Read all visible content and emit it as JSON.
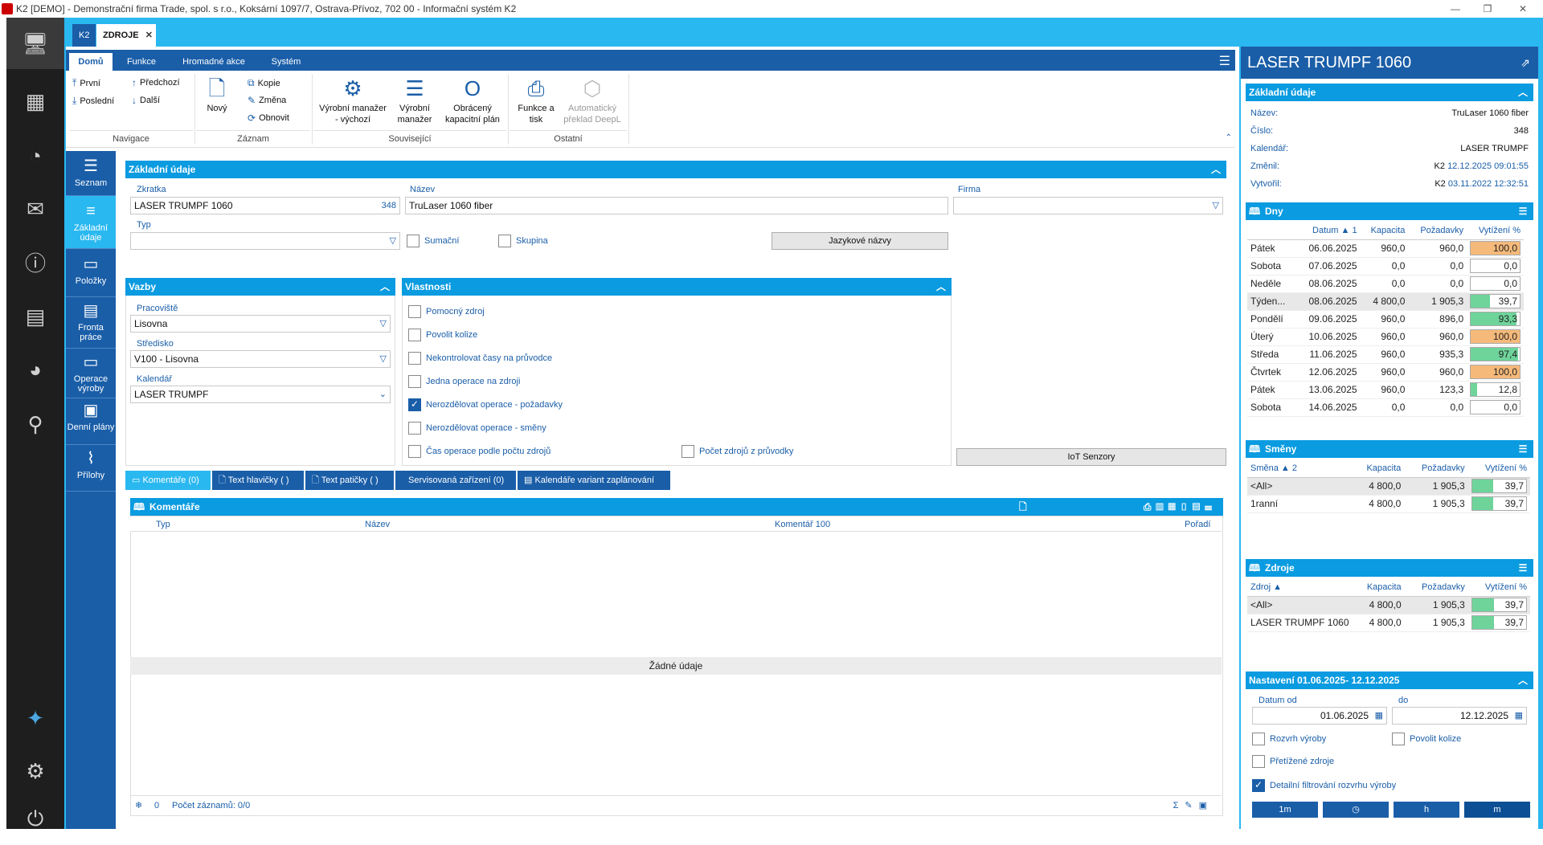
{
  "window": {
    "title": "K2 [DEMO] - Demonstrační firma Trade, spol. s r.o., Koksární 1097/7, Ostrava-Přívoz, 702 00 - Informační systém K2"
  },
  "doc_tabs": {
    "k2": "K2",
    "active": "ZDROJE",
    "close": "✕"
  },
  "ribbon_tabs": [
    "Domů",
    "Funkce",
    "Hromadné akce",
    "Systém"
  ],
  "ribbon": {
    "nav": {
      "first": "První",
      "last": "Poslední",
      "prev": "Předchozí",
      "next": "Další",
      "group": "Navigace"
    },
    "record": {
      "new": "Nový",
      "copy": "Kopie",
      "change": "Změna",
      "refresh": "Obnovit",
      "group": "Záznam"
    },
    "related": {
      "pm_default": "Výrobní manažer\n- výchozí",
      "pm": "Výrobní\nmanažer",
      "reverse_plan": "Obrácený\nkapacitní plán",
      "group": "Související"
    },
    "other": {
      "print": "Funkce a\ntisk",
      "deepl": "Automatický\npřeklad DeepL",
      "group": "Ostatní"
    }
  },
  "sidenav": [
    {
      "label": "Seznam",
      "icon": "list-icon"
    },
    {
      "label": "Základní údaje",
      "icon": "details-icon"
    },
    {
      "label": "Položky",
      "icon": "items-icon"
    },
    {
      "label": "Fronta práce",
      "icon": "queue-icon"
    },
    {
      "label": "Operace výroby",
      "icon": "operations-icon"
    },
    {
      "label": "Denní plány",
      "icon": "daily-plan-icon"
    },
    {
      "label": "Přílohy",
      "icon": "attachment-icon"
    }
  ],
  "basic": {
    "title": "Základní údaje",
    "abbr_label": "Zkratka",
    "abbr": "LASER TRUMPF 1060",
    "abbr_num": "348",
    "name_label": "Název",
    "name": "TruLaser 1060 fiber",
    "firm_label": "Firma",
    "firm": "",
    "type_label": "Typ",
    "type": "",
    "sum_label": "Sumační",
    "group_label": "Skupina",
    "lang_btn": "Jazykové názvy"
  },
  "links": {
    "title": "Vazby",
    "workplace_label": "Pracoviště",
    "workplace": "Lisovna",
    "center_label": "Středisko",
    "center": "V100 - Lisovna",
    "calendar_label": "Kalendář",
    "calendar": "LASER TRUMPF"
  },
  "props": {
    "title": "Vlastnosti",
    "items": [
      {
        "label": "Pomocný zdroj",
        "checked": false
      },
      {
        "label": "Povolit kolize",
        "checked": false
      },
      {
        "label": "Nekontrolovat časy na průvodce",
        "checked": false
      },
      {
        "label": "Jedna operace na zdroji",
        "checked": false
      },
      {
        "label": "Nerozdělovat operace - požadavky",
        "checked": true
      },
      {
        "label": "Nerozdělovat operace - směny",
        "checked": false
      },
      {
        "label": "Čas operace podle počtu zdrojů",
        "checked": false
      }
    ],
    "count_label": "Počet zdrojů z průvodky",
    "iot_btn": "IoT Senzory"
  },
  "bottom_tabs": [
    "Komentáře (0)",
    "Text hlavičky ( )",
    "Text patičky ( )",
    "Servisovaná zařízení (0)",
    "Kalendáře variant zaplánování"
  ],
  "comments": {
    "title": "Komentáře",
    "cols": [
      "Typ",
      "Název",
      "Komentář 100",
      "Pořadí"
    ],
    "empty": "Žádné údaje",
    "footer_count": "0",
    "footer_records": "Počet záznamů: 0/0"
  },
  "right": {
    "title": "LASER TRUMPF 1060",
    "basic_title": "Základní údaje",
    "kv": [
      {
        "k": "Název:",
        "v": "TruLaser 1060 fiber",
        "d": ""
      },
      {
        "k": "Číslo:",
        "v": "348",
        "d": ""
      },
      {
        "k": "Kalendář:",
        "v": "LASER TRUMPF",
        "d": ""
      },
      {
        "k": "Změnil:",
        "v": "K2",
        "d": "12.12.2025 09:01:55"
      },
      {
        "k": "Vytvořil:",
        "v": "K2",
        "d": "03.11.2022 12:32:51"
      }
    ],
    "days_title": "Dny",
    "days_cols": [
      "",
      "Datum ▲ 1",
      "Kapacita",
      "Požadavky",
      "Vytížení %"
    ],
    "days": [
      {
        "day": "Pátek",
        "date": "06.06.2025",
        "cap": "960,0",
        "req": "960,0",
        "util": "100,0",
        "pct": 100,
        "color": "#f5b97a"
      },
      {
        "day": "Sobota",
        "date": "07.06.2025",
        "cap": "0,0",
        "req": "0,0",
        "util": "0,0",
        "pct": 0,
        "color": "#6ed49a"
      },
      {
        "day": "Neděle",
        "date": "08.06.2025",
        "cap": "0,0",
        "req": "0,0",
        "util": "0,0",
        "pct": 0,
        "color": "#6ed49a"
      },
      {
        "day": "Týden...",
        "date": "08.06.2025",
        "cap": "4 800,0",
        "req": "1 905,3",
        "util": "39,7",
        "pct": 39.7,
        "color": "#6ed49a"
      },
      {
        "day": "Pondělí",
        "date": "09.06.2025",
        "cap": "960,0",
        "req": "896,0",
        "util": "93,3",
        "pct": 93.3,
        "color": "#6ed49a"
      },
      {
        "day": "Úterý",
        "date": "10.06.2025",
        "cap": "960,0",
        "req": "960,0",
        "util": "100,0",
        "pct": 100,
        "color": "#f5b97a"
      },
      {
        "day": "Středa",
        "date": "11.06.2025",
        "cap": "960,0",
        "req": "935,3",
        "util": "97,4",
        "pct": 97.4,
        "color": "#6ed49a"
      },
      {
        "day": "Čtvrtek",
        "date": "12.06.2025",
        "cap": "960,0",
        "req": "960,0",
        "util": "100,0",
        "pct": 100,
        "color": "#f5b97a"
      },
      {
        "day": "Pátek",
        "date": "13.06.2025",
        "cap": "960,0",
        "req": "123,3",
        "util": "12,8",
        "pct": 12.8,
        "color": "#6ed49a"
      },
      {
        "day": "Sobota",
        "date": "14.06.2025",
        "cap": "0,0",
        "req": "0,0",
        "util": "0,0",
        "pct": 0,
        "color": "#6ed49a"
      }
    ],
    "shifts_title": "Směny",
    "shifts_cols": [
      "Směna ▲ 2",
      "Kapacita",
      "Požadavky",
      "Vytížení %"
    ],
    "shifts": [
      {
        "name": "<All>",
        "cap": "4 800,0",
        "req": "1 905,3",
        "util": "39,7",
        "pct": 39.7
      },
      {
        "name": "1ranní",
        "cap": "4 800,0",
        "req": "1 905,3",
        "util": "39,7",
        "pct": 39.7
      }
    ],
    "res_title": "Zdroje",
    "res_cols": [
      "Zdroj ▲",
      "Kapacita",
      "Požadavky",
      "Vytížení %"
    ],
    "res": [
      {
        "name": "<All>",
        "cap": "4 800,0",
        "req": "1 905,3",
        "util": "39,7",
        "pct": 39.7
      },
      {
        "name": "LASER TRUMPF 1060",
        "cap": "4 800,0",
        "req": "1 905,3",
        "util": "39,7",
        "pct": 39.7
      }
    ],
    "settings_title": "Nastavení 01.06.2025- 12.12.2025",
    "from_label": "Datum od",
    "from": "01.06.2025",
    "to_label": "do",
    "to": "12.12.2025",
    "opts": [
      {
        "label": "Rozvrh výroby",
        "checked": false
      },
      {
        "label": "Povolit kolize",
        "checked": false
      },
      {
        "label": "Přetížené zdroje",
        "checked": false
      },
      {
        "label": "Detailní filtrování rozvrhu výroby",
        "checked": true
      }
    ],
    "buttons": [
      "1m",
      "◷",
      "h",
      "m"
    ]
  }
}
